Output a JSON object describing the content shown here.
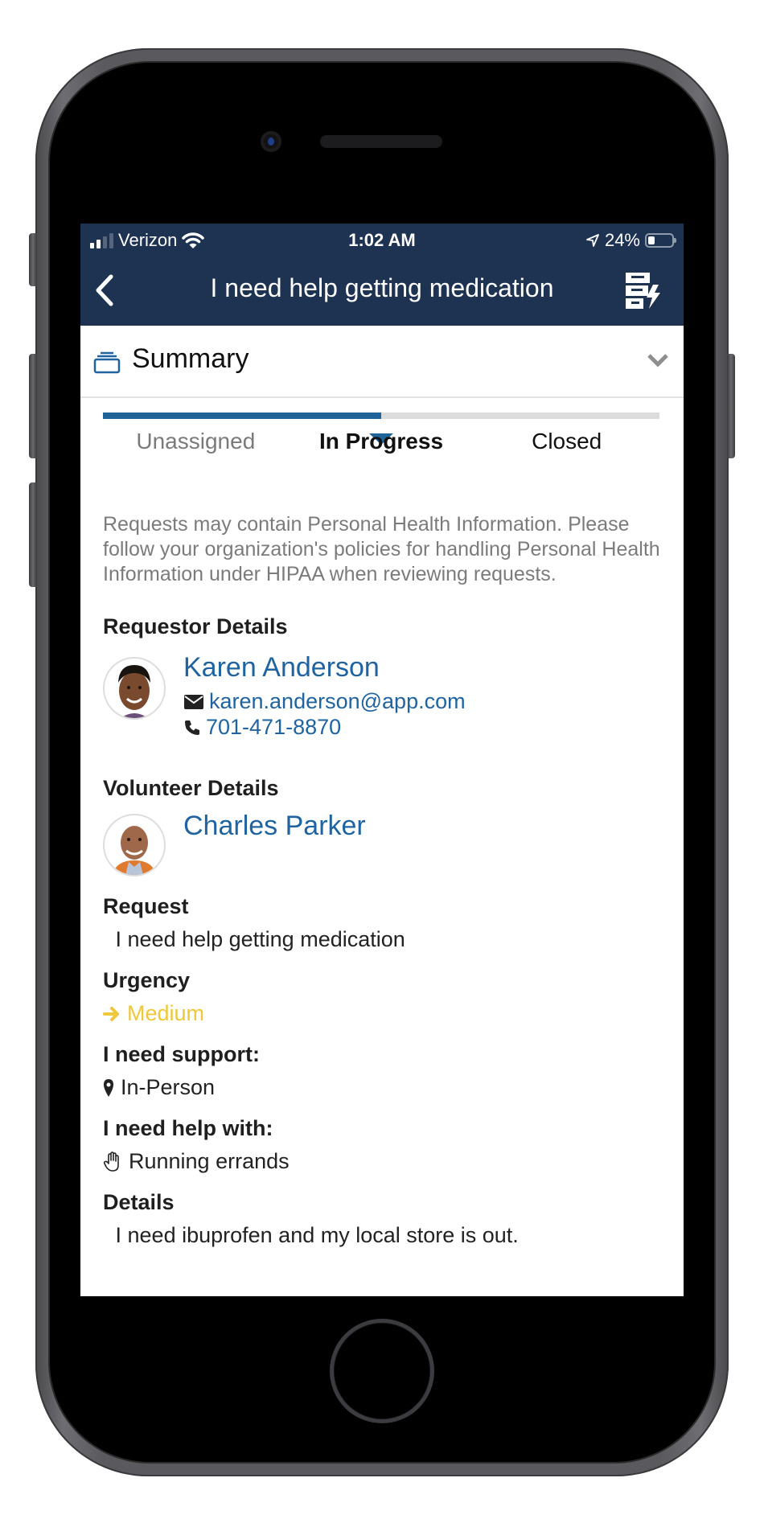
{
  "status_bar": {
    "carrier": "Verizon",
    "time": "1:02 AM",
    "battery_percent": "24%",
    "signal_bars_active": 2,
    "signal_bars_total": 4
  },
  "nav": {
    "back_icon": "chevron-left-icon",
    "title": "I need help getting medication",
    "action_icon": "filing-cabinet-lightning-icon"
  },
  "summary": {
    "label": "Summary",
    "icon": "inbox-tray-icon",
    "chevron": "chevron-down-icon"
  },
  "progress": {
    "steps": [
      {
        "label": "Unassigned",
        "state": "past"
      },
      {
        "label": "In Progress",
        "state": "current"
      },
      {
        "label": "Closed",
        "state": "future"
      }
    ],
    "current_index": 1,
    "fill_fraction": 0.5
  },
  "notice": "Requests may contain Personal Health Information. Please follow your organization's policies for handling Personal Health Information under HIPAA when reviewing requests.",
  "requestor": {
    "heading": "Requestor Details",
    "name": "Karen Anderson",
    "email": "karen.anderson@app.com",
    "phone": "701-471-8870"
  },
  "volunteer": {
    "heading": "Volunteer Details",
    "name": "Charles Parker"
  },
  "fields": {
    "request_label": "Request",
    "request_value": "I need help getting medication",
    "urgency_label": "Urgency",
    "urgency_value": "Medium",
    "support_label": "I need support:",
    "support_value": "In-Person",
    "help_label": "I need help with:",
    "help_value": "Running errands",
    "details_label": "Details",
    "details_value": "I need ibuprofen and my local store is out."
  },
  "colors": {
    "nav_bg": "#1e3252",
    "accent_blue": "#1f63a0",
    "urgency_medium": "#eec73a",
    "muted_text": "#7b7b7b"
  }
}
